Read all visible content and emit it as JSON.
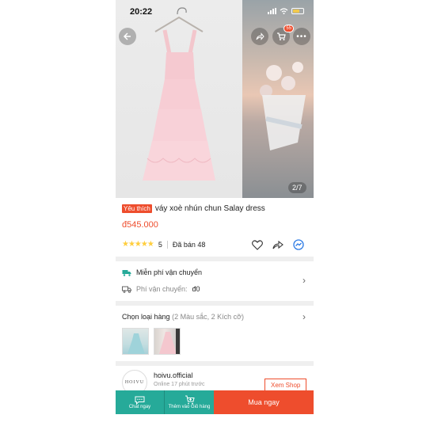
{
  "status": {
    "time": "20:22"
  },
  "gallery": {
    "counter": "2/7",
    "cart_count": "55"
  },
  "product": {
    "badge": "Yêu thích",
    "title": "váy xoè nhún chun Salay dress",
    "price": "đ545.000",
    "rating": "5",
    "sold": "Đã bán 48",
    "stars": "★★★★★"
  },
  "shipping": {
    "free_label": "Miễn phí vận chuyển",
    "fee_label": "Phí vận chuyển:",
    "fee_value": "đ0"
  },
  "variants": {
    "label": "Chọn loại hàng",
    "summary": "(2 Màu sắc, 2 Kích cỡ)"
  },
  "shop": {
    "avatar_text": "HOIVU",
    "name": "hoivu.official",
    "online": "Online 17 phút trước",
    "view_button": "Xem Shop"
  },
  "bottom_bar": {
    "chat_label": "Chat ngay",
    "cart_label": "Thêm vào Giỏ hàng",
    "buy_label": "Mua ngay"
  },
  "colors": {
    "accent": "#ee4d2d",
    "teal": "#26aa99",
    "star": "#ffce3d"
  }
}
